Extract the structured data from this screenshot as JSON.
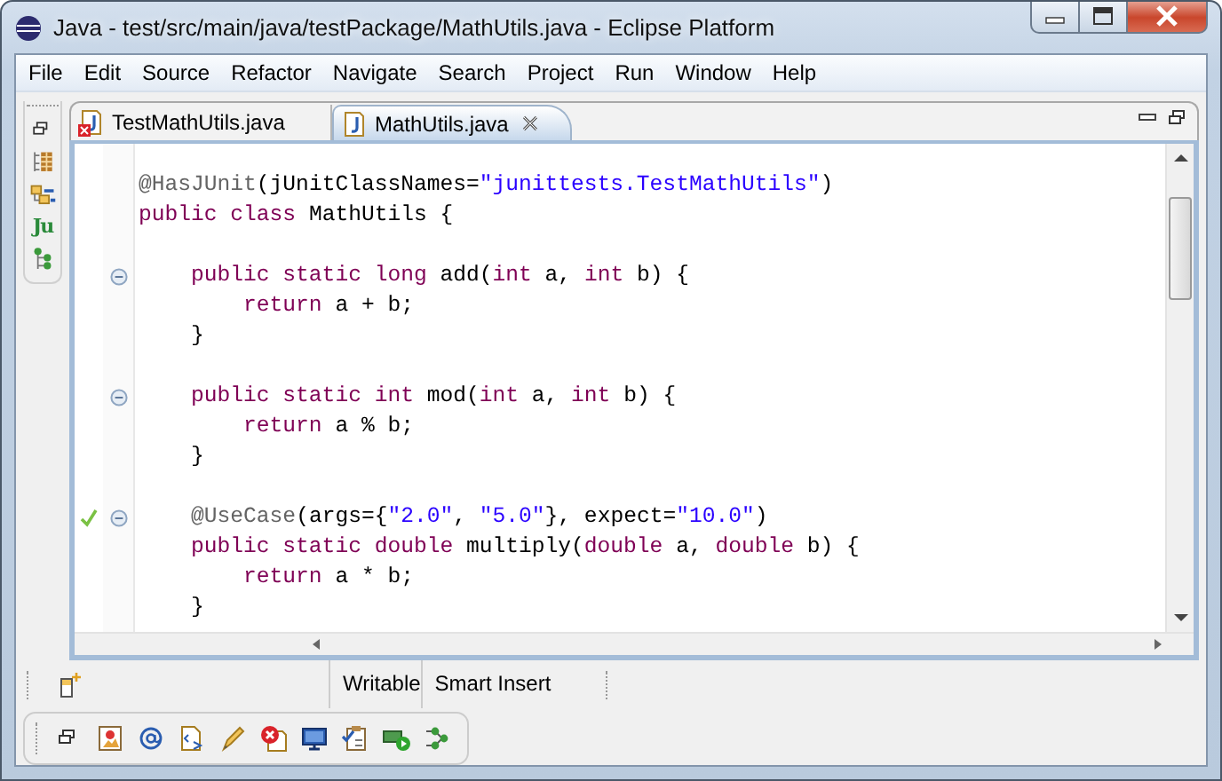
{
  "window": {
    "title": "Java - test/src/main/java/testPackage/MathUtils.java - Eclipse Platform"
  },
  "menu": [
    {
      "label": "File"
    },
    {
      "label": "Edit"
    },
    {
      "label": "Source"
    },
    {
      "label": "Refactor"
    },
    {
      "label": "Navigate"
    },
    {
      "label": "Search"
    },
    {
      "label": "Project"
    },
    {
      "label": "Run"
    },
    {
      "label": "Window"
    },
    {
      "label": "Help"
    }
  ],
  "left_trim": [
    {
      "kind": "restore"
    },
    {
      "kind": "hierarchy"
    },
    {
      "kind": "outline"
    },
    {
      "kind": "junit",
      "glyph": "Ju"
    },
    {
      "kind": "tree"
    }
  ],
  "tabs": [
    {
      "label": "TestMathUtils.java",
      "selected": false,
      "error": true
    },
    {
      "label": "MathUtils.java",
      "selected": true,
      "error": false
    }
  ],
  "editor": {
    "lines": [
      {
        "kind": "code",
        "collapsible": false,
        "passed": false,
        "segments": [
          {
            "kind": "annotation",
            "text": "@HasJUnit"
          },
          {
            "kind": "plain",
            "text": "(jUnitClassNames="
          },
          {
            "kind": "string",
            "text": "\"junittests.TestMathUtils\""
          },
          {
            "kind": "plain",
            "text": ")"
          }
        ]
      },
      {
        "kind": "code",
        "collapsible": false,
        "passed": false,
        "segments": [
          {
            "kind": "keyword",
            "text": "public class"
          },
          {
            "kind": "plain",
            "text": " MathUtils {"
          }
        ]
      },
      {
        "kind": "blank"
      },
      {
        "kind": "code",
        "collapsible": true,
        "passed": false,
        "segments": [
          {
            "kind": "keyword",
            "text": "    public static long"
          },
          {
            "kind": "plain",
            "text": " add("
          },
          {
            "kind": "keyword",
            "text": "int"
          },
          {
            "kind": "plain",
            "text": " a, "
          },
          {
            "kind": "keyword",
            "text": "int"
          },
          {
            "kind": "plain",
            "text": " b) {"
          }
        ]
      },
      {
        "kind": "code",
        "collapsible": false,
        "passed": false,
        "segments": [
          {
            "kind": "keyword",
            "text": "        return"
          },
          {
            "kind": "plain",
            "text": " a + b;"
          }
        ]
      },
      {
        "kind": "code",
        "collapsible": false,
        "passed": false,
        "segments": [
          {
            "kind": "plain",
            "text": "    }"
          }
        ]
      },
      {
        "kind": "blank"
      },
      {
        "kind": "code",
        "collapsible": true,
        "passed": false,
        "segments": [
          {
            "kind": "keyword",
            "text": "    public static int"
          },
          {
            "kind": "plain",
            "text": " mod("
          },
          {
            "kind": "keyword",
            "text": "int"
          },
          {
            "kind": "plain",
            "text": " a, "
          },
          {
            "kind": "keyword",
            "text": "int"
          },
          {
            "kind": "plain",
            "text": " b) {"
          }
        ]
      },
      {
        "kind": "code",
        "collapsible": false,
        "passed": false,
        "segments": [
          {
            "kind": "keyword",
            "text": "        return"
          },
          {
            "kind": "plain",
            "text": " a % b;"
          }
        ]
      },
      {
        "kind": "code",
        "collapsible": false,
        "passed": false,
        "segments": [
          {
            "kind": "plain",
            "text": "    }"
          }
        ]
      },
      {
        "kind": "blank"
      },
      {
        "kind": "code",
        "collapsible": true,
        "passed": true,
        "segments": [
          {
            "kind": "annotation",
            "text": "    @UseCase"
          },
          {
            "kind": "plain",
            "text": "(args={"
          },
          {
            "kind": "string",
            "text": "\"2.0\""
          },
          {
            "kind": "plain",
            "text": ", "
          },
          {
            "kind": "string",
            "text": "\"5.0\""
          },
          {
            "kind": "plain",
            "text": "}, expect="
          },
          {
            "kind": "string",
            "text": "\"10.0\""
          },
          {
            "kind": "plain",
            "text": ")"
          }
        ]
      },
      {
        "kind": "code",
        "collapsible": false,
        "passed": false,
        "segments": [
          {
            "kind": "keyword",
            "text": "    public static double"
          },
          {
            "kind": "plain",
            "text": " multiply("
          },
          {
            "kind": "keyword",
            "text": "double"
          },
          {
            "kind": "plain",
            "text": " a, "
          },
          {
            "kind": "keyword",
            "text": "double"
          },
          {
            "kind": "plain",
            "text": " b) {"
          }
        ]
      },
      {
        "kind": "code",
        "collapsible": false,
        "passed": false,
        "segments": [
          {
            "kind": "keyword",
            "text": "        return"
          },
          {
            "kind": "plain",
            "text": " a * b;"
          }
        ]
      },
      {
        "kind": "code",
        "collapsible": false,
        "passed": false,
        "segments": [
          {
            "kind": "plain",
            "text": "    }"
          }
        ]
      }
    ]
  },
  "status_bar": {
    "fields": [
      "Writable",
      "Smart Insert"
    ]
  },
  "bottom_toolbar": [
    {
      "kind": "restore"
    },
    {
      "kind": "image"
    },
    {
      "kind": "at"
    },
    {
      "kind": "document"
    },
    {
      "kind": "pen"
    },
    {
      "kind": "error"
    },
    {
      "kind": "monitor"
    },
    {
      "kind": "tasks"
    },
    {
      "kind": "run"
    },
    {
      "kind": "nodes"
    }
  ]
}
